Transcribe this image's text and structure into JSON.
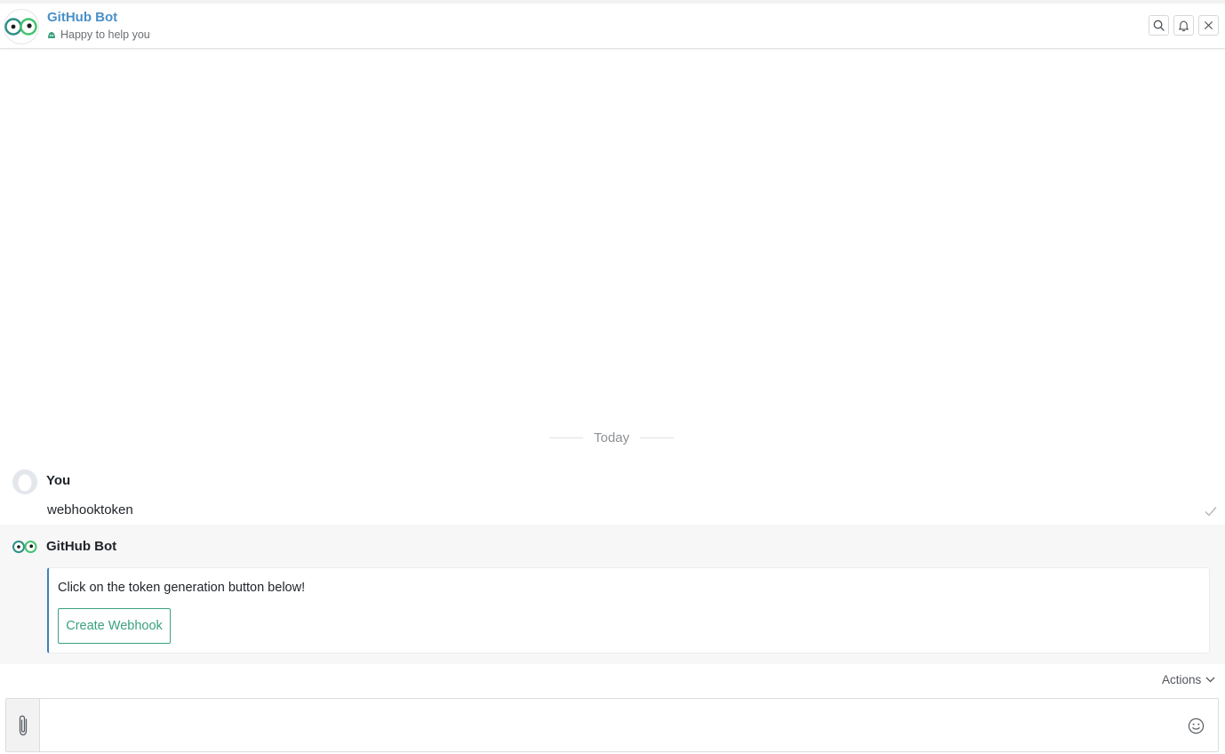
{
  "header": {
    "bot_name": "GitHub Bot",
    "status_text": "Happy to help you",
    "icons": [
      "search-icon",
      "bell-icon",
      "close-icon"
    ]
  },
  "chat": {
    "date_divider": "Today",
    "user_message": {
      "sender": "You",
      "text": "webhooktoken",
      "status_icon": "check-icon"
    },
    "bot_message": {
      "sender": "GitHub Bot",
      "text": "Click on the token generation button below!",
      "button_label": "Create Webhook"
    }
  },
  "footer": {
    "actions_label": "Actions",
    "input_placeholder": "",
    "icons": [
      "paperclip-icon",
      "emoji-icon",
      "chevron-down-icon"
    ]
  },
  "colors": {
    "bot_name": "#4a90c8",
    "accent_green": "#3aa17e",
    "card_border": "#3d7fc1"
  }
}
